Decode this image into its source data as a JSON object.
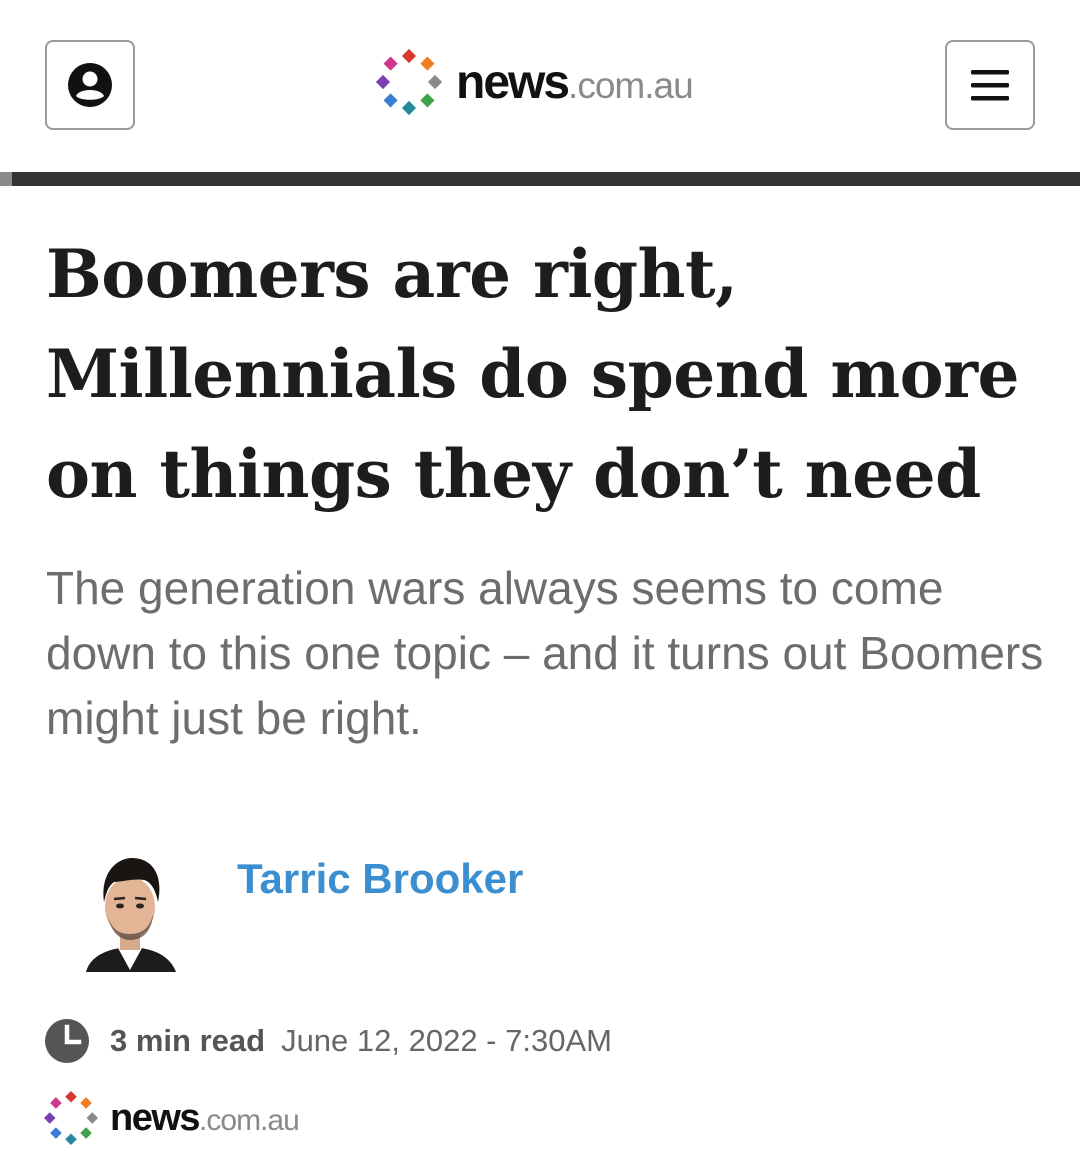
{
  "header": {
    "account_icon": "account-circle-icon",
    "menu_icon": "hamburger-menu-icon",
    "logo": {
      "news": "news",
      "domain": ".com.au"
    },
    "logo_colors": [
      "#d63a2f",
      "#ef7d22",
      "#8a8a8a",
      "#3fa34d",
      "#24899a",
      "#3a7fd6",
      "#7b3fb4",
      "#d1358d"
    ]
  },
  "article": {
    "headline": "Boomers are right, Millennials do spend more on things they don’t need",
    "standfirst": "The generation wars always seems to come down to this one topic – and it turns out Boomers might just be right.",
    "author": {
      "name": "Tarric Brooker",
      "photo": "author-headshot"
    },
    "read_time": "3 min read",
    "published": "June 12, 2022 - 7:30AM",
    "clock_icon": "clock-icon",
    "source_logo": {
      "news": "news",
      "domain": ".com.au"
    }
  },
  "colors": {
    "author_link": "#3b8fd0",
    "header_rule": "#333333",
    "standfirst": "#6d6d6d"
  }
}
